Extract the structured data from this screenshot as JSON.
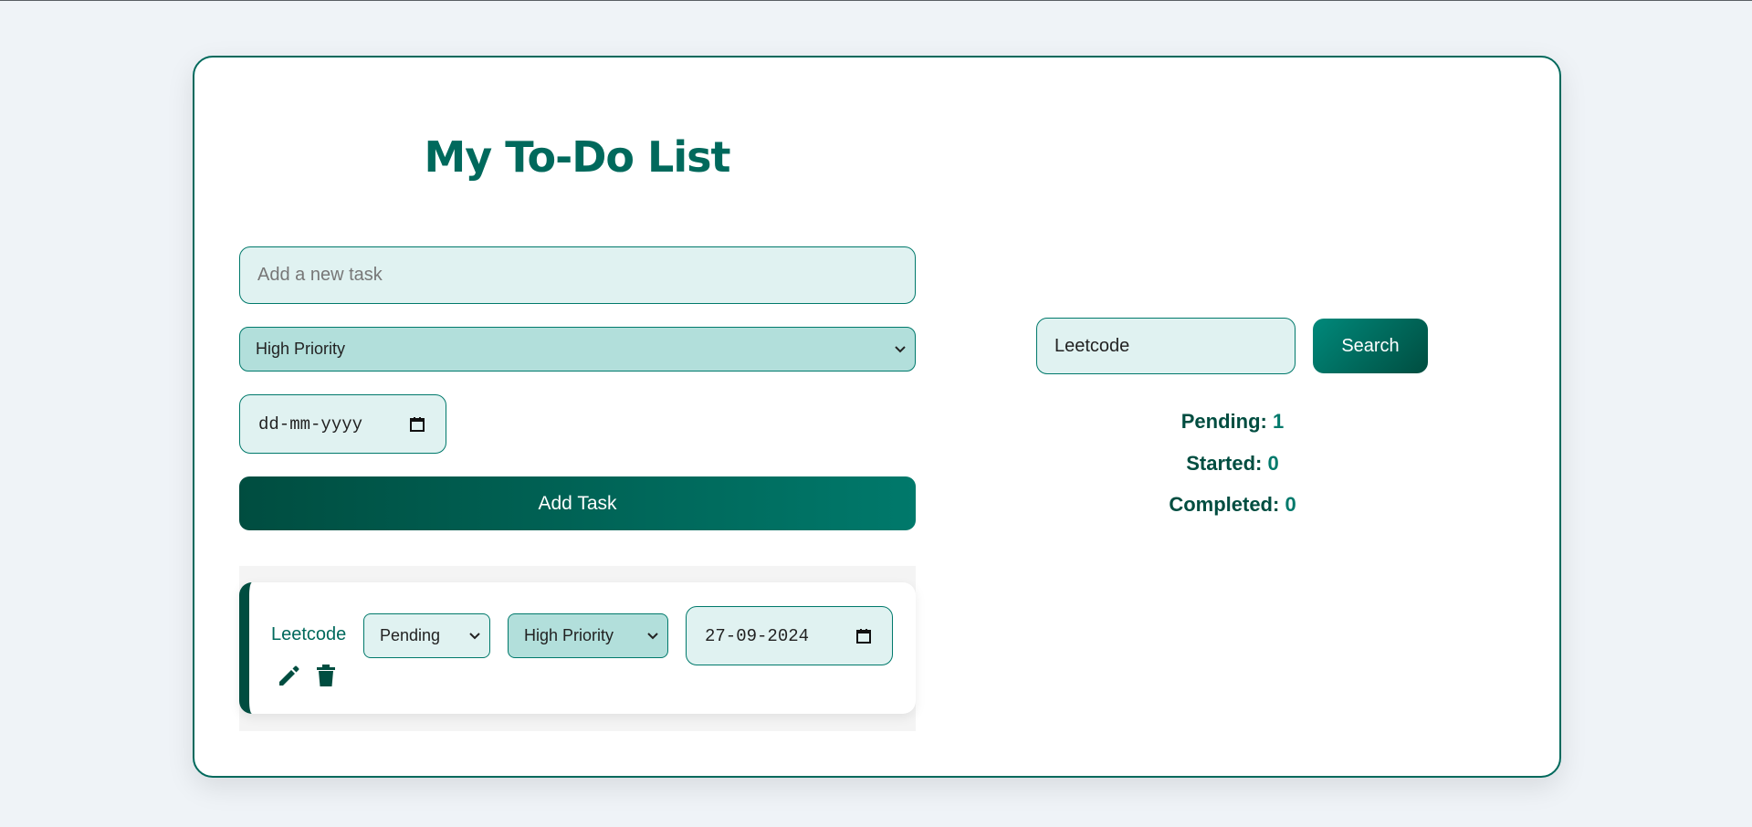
{
  "app": {
    "title": "My To-Do List"
  },
  "form": {
    "task_placeholder": "Add a new task",
    "task_value": "",
    "priority_selected": "High Priority",
    "date_placeholder": "dd-mm-yyyy",
    "add_label": "Add Task"
  },
  "tasks": [
    {
      "name": "Leetcode",
      "status": "Pending",
      "priority": "High Priority",
      "date": "27-09-2024",
      "edit_icon": "pencil-icon",
      "delete_icon": "trash-icon"
    }
  ],
  "search": {
    "value": "Leetcode",
    "button_label": "Search"
  },
  "stats": {
    "pending_label": "Pending:",
    "pending_count": "1",
    "started_label": "Started:",
    "started_count": "0",
    "completed_label": "Completed:",
    "completed_count": "0"
  },
  "colors": {
    "accent": "#00695c",
    "accent_dark": "#004d40",
    "field_bg": "#e0f2f1",
    "priority_bg": "#b2dfdb",
    "page_bg": "#eff3f7"
  }
}
